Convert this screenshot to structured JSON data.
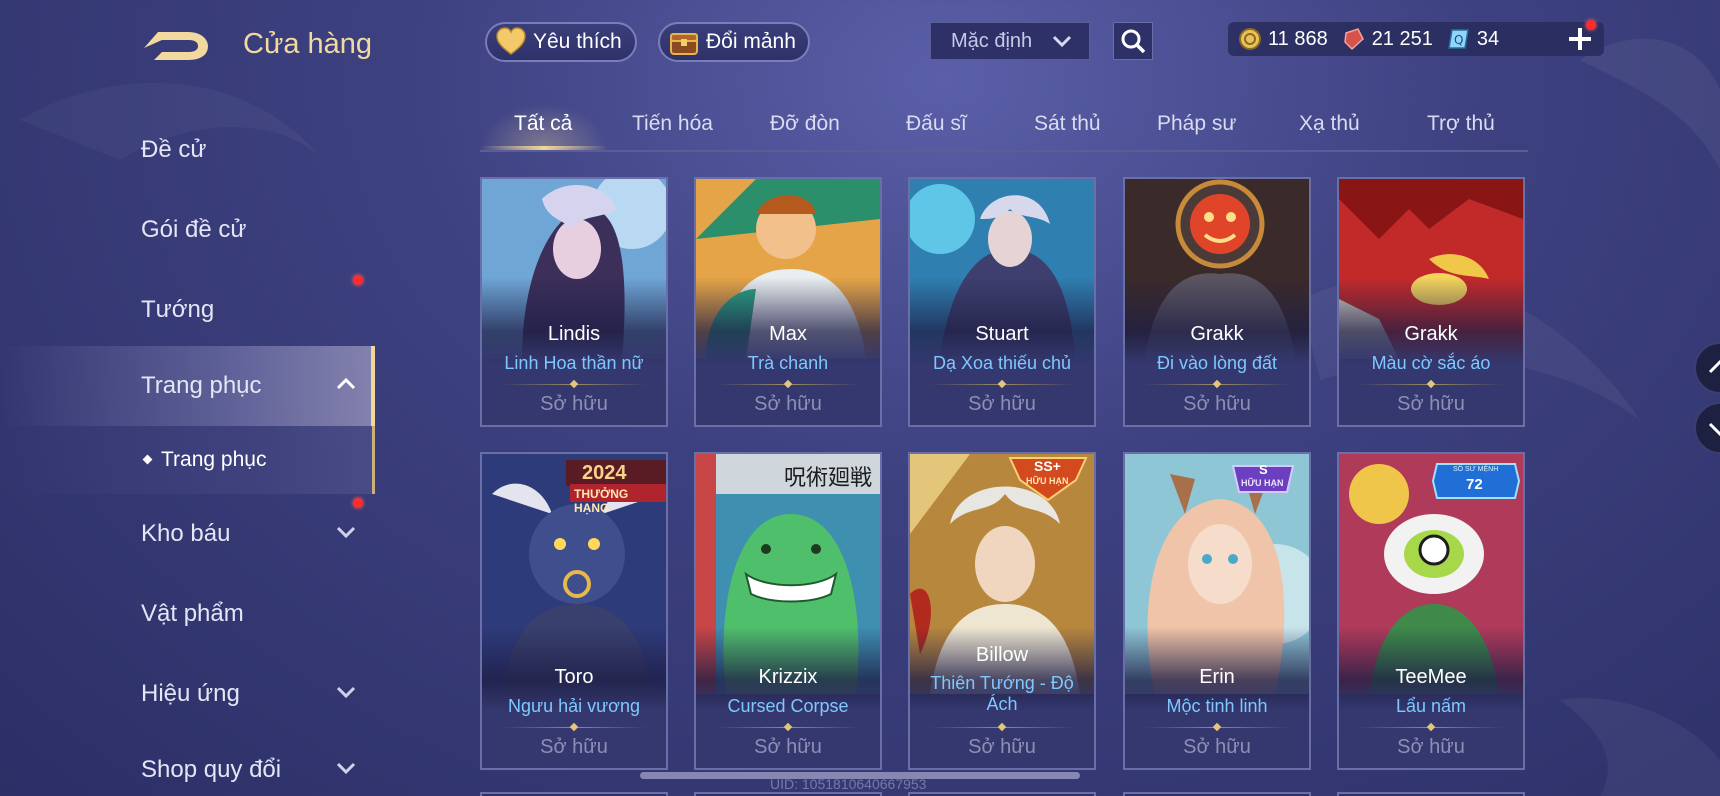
{
  "header": {
    "title": "Cửa hàng",
    "favorites_label": "Yêu thích",
    "shard_exchange_label": "Đổi mảnh",
    "sort_selected": "Mặc định",
    "currencies": [
      {
        "icon": "gold-coin-icon",
        "value": "11 868"
      },
      {
        "icon": "gem-icon",
        "value": "21 251"
      },
      {
        "icon": "voucher-icon",
        "value": "34"
      }
    ]
  },
  "sidebar": {
    "items": [
      {
        "label": "Đề cử"
      },
      {
        "label": "Gói đề cử"
      },
      {
        "label": "Tướng"
      },
      {
        "label": "Trang phục"
      },
      {
        "label": "Kho báu"
      },
      {
        "label": "Vật phẩm"
      },
      {
        "label": "Hiệu ứng"
      },
      {
        "label": "Shop quy đổi"
      }
    ],
    "sub_item": "Trang phục"
  },
  "tabs": [
    "Tất cả",
    "Tiến hóa",
    "Đỡ đòn",
    "Đấu sĩ",
    "Sát thủ",
    "Pháp sư",
    "Xạ thủ",
    "Trợ thủ"
  ],
  "cards": [
    {
      "hero": "Lindis",
      "skin": "Linh Hoa thần nữ",
      "status": "Sở hữu"
    },
    {
      "hero": "Max",
      "skin": "Trà chanh",
      "status": "Sở hữu"
    },
    {
      "hero": "Stuart",
      "skin": "Dạ Xoa thiếu chủ",
      "status": "Sở hữu"
    },
    {
      "hero": "Grakk",
      "skin": "Đi vào lòng đất",
      "status": "Sở hữu"
    },
    {
      "hero": "Grakk",
      "skin": "Màu cờ sắc áo",
      "status": "Sở hữu"
    },
    {
      "hero": "Toro",
      "skin": "Ngưu hải vương",
      "status": "Sở hữu",
      "badge_year": "2024",
      "badge_text": "THƯỞNG HẠNG"
    },
    {
      "hero": "Krizzix",
      "skin": "Cursed Corpse",
      "status": "Sở hữu",
      "badge_text": "呪術廻戦"
    },
    {
      "hero": "Billow",
      "skin": "Thiên Tướng - Độ Ách",
      "status": "Sở hữu",
      "badge_rank": "SS+",
      "badge_text": "HỮU HẠN"
    },
    {
      "hero": "Erin",
      "skin": "Mộc tinh linh",
      "status": "Sở hữu",
      "badge_rank": "S",
      "badge_text": "HỮU HẠN"
    },
    {
      "hero": "TeeMee",
      "skin": "Lẩu nấm",
      "status": "Sở hữu",
      "badge_text": "SỐ SỨ MỆNH",
      "badge_number": "72"
    }
  ],
  "footer": {
    "uid": "UID: 1051810640667953"
  },
  "colors": {
    "accent_gold": "#f0d79c",
    "skin_name": "#7ec8ff",
    "owned_text": "#8d8fb5",
    "notification": "#ff2c2c"
  }
}
